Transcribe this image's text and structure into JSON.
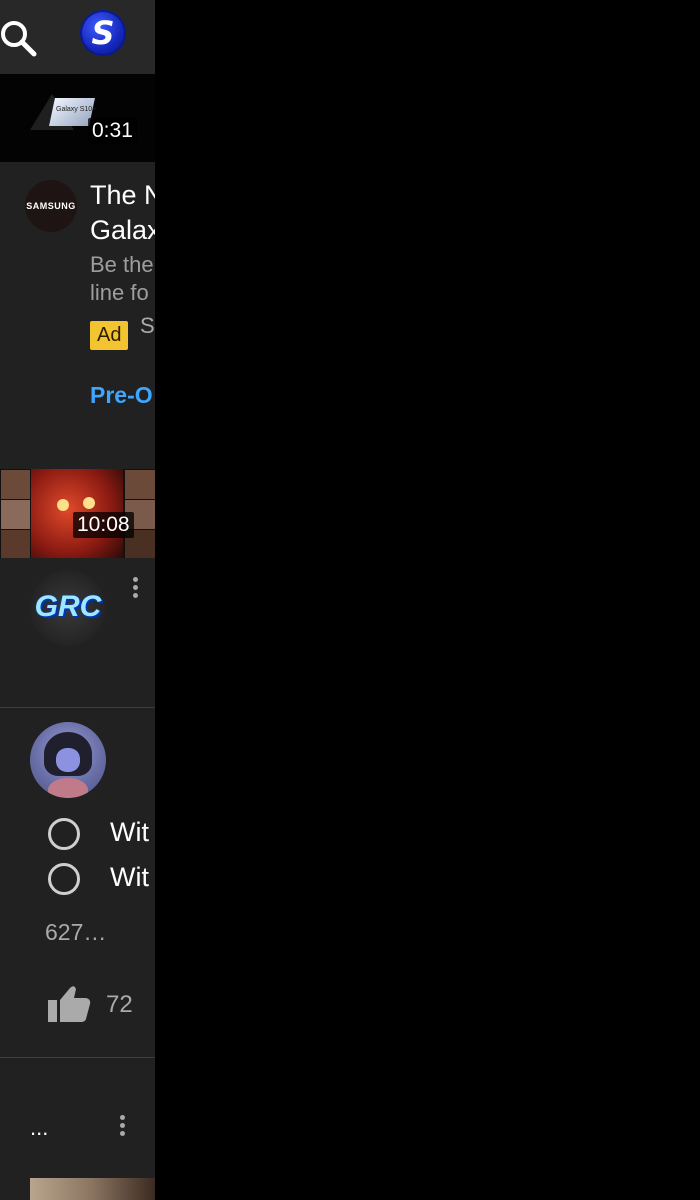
{
  "feed": {
    "video1": {
      "duration": "0:31",
      "thumb_text": "Galaxy S10+"
    },
    "ad": {
      "advertiser_logo_text": "SAMSUNG",
      "title": "The N\nGalax",
      "description": "Be the\nline fo",
      "badge": "Ad",
      "sponsor": "S",
      "cta": "Pre-O"
    },
    "video2": {
      "duration": "10:08",
      "channel_avatar_text": "GRC"
    },
    "post": {
      "option1": "Wit",
      "option2": "Wit",
      "vote_count": "627…",
      "like_count": "72"
    },
    "next_item": {
      "ellipsis": "..."
    }
  },
  "header": {
    "logo_letter": "S"
  },
  "colors": {
    "app_bg": "#212121",
    "header_bg": "#282828",
    "link": "#3ea6ff",
    "ad_badge": "#f4c430"
  }
}
